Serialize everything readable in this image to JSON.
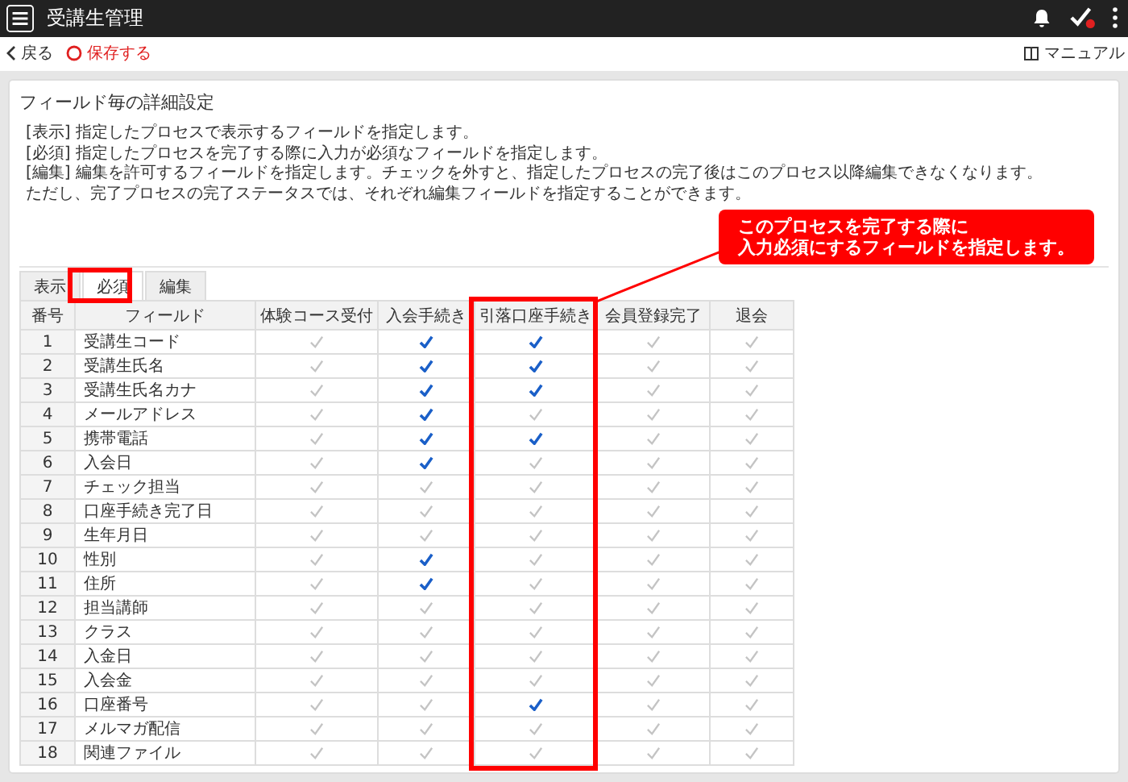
{
  "app_bar": {
    "title": "受講生管理"
  },
  "toolbar": {
    "back": "戻る",
    "save": "保存する",
    "manual": "マニュアル"
  },
  "panel": {
    "title": "フィールド毎の詳細設定",
    "descriptions": [
      "[表示] 指定したプロセスで表示するフィールドを指定します。",
      "[必須] 指定したプロセスを完了する際に入力が必須なフィールドを指定します。",
      "[編集] 編集を許可するフィールドを指定します。チェックを外すと、指定したプロセスの完了後はこのプロセス以降編集できなくなります。",
      "ただし、完了プロセスの完了ステータスでは、それぞれ編集フィールドを指定することができます。"
    ]
  },
  "tabs": [
    {
      "label": "表示",
      "selected": false
    },
    {
      "label": "必須",
      "selected": true
    },
    {
      "label": "編集",
      "selected": false
    }
  ],
  "callout": {
    "lines": [
      "このプロセスを完了する際に",
      "入力必須にするフィールドを指定します。"
    ]
  },
  "table": {
    "columns": [
      "番号",
      "フィールド",
      "体験コース受付",
      "入会手続き",
      "引落口座手続き",
      "会員登録完了",
      "退会"
    ],
    "rows": [
      {
        "no": "1",
        "field": "受講生コード",
        "checks": [
          false,
          true,
          true,
          false,
          false
        ]
      },
      {
        "no": "2",
        "field": "受講生氏名",
        "checks": [
          false,
          true,
          true,
          false,
          false
        ]
      },
      {
        "no": "3",
        "field": "受講生氏名カナ",
        "checks": [
          false,
          true,
          true,
          false,
          false
        ]
      },
      {
        "no": "4",
        "field": "メールアドレス",
        "checks": [
          false,
          true,
          false,
          false,
          false
        ]
      },
      {
        "no": "5",
        "field": "携帯電話",
        "checks": [
          false,
          true,
          true,
          false,
          false
        ]
      },
      {
        "no": "6",
        "field": "入会日",
        "checks": [
          false,
          true,
          false,
          false,
          false
        ]
      },
      {
        "no": "7",
        "field": "チェック担当",
        "checks": [
          false,
          false,
          false,
          false,
          false
        ]
      },
      {
        "no": "8",
        "field": "口座手続き完了日",
        "checks": [
          false,
          false,
          false,
          false,
          false
        ]
      },
      {
        "no": "9",
        "field": "生年月日",
        "checks": [
          false,
          false,
          false,
          false,
          false
        ]
      },
      {
        "no": "10",
        "field": "性別",
        "checks": [
          false,
          true,
          false,
          false,
          false
        ]
      },
      {
        "no": "11",
        "field": "住所",
        "checks": [
          false,
          true,
          false,
          false,
          false
        ]
      },
      {
        "no": "12",
        "field": "担当講師",
        "checks": [
          false,
          false,
          false,
          false,
          false
        ]
      },
      {
        "no": "13",
        "field": "クラス",
        "checks": [
          false,
          false,
          false,
          false,
          false
        ]
      },
      {
        "no": "14",
        "field": "入金日",
        "checks": [
          false,
          false,
          false,
          false,
          false
        ]
      },
      {
        "no": "15",
        "field": "入会金",
        "checks": [
          false,
          false,
          false,
          false,
          false
        ]
      },
      {
        "no": "16",
        "field": "口座番号",
        "checks": [
          false,
          false,
          true,
          false,
          false
        ]
      },
      {
        "no": "17",
        "field": "メルマガ配信",
        "checks": [
          false,
          false,
          false,
          false,
          false
        ]
      },
      {
        "no": "18",
        "field": "関連ファイル",
        "checks": [
          false,
          false,
          false,
          false,
          false
        ]
      }
    ]
  }
}
